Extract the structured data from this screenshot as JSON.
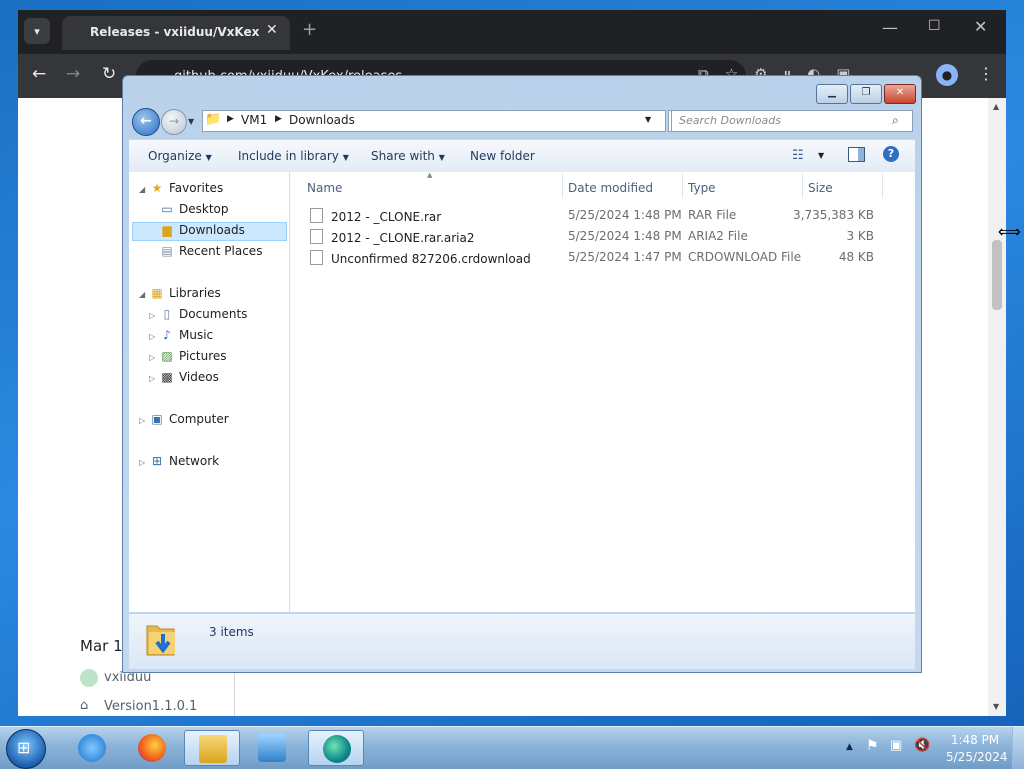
{
  "browser": {
    "tab_title": "Releases - vxiiduu/VxKex",
    "url": "github.com/vxiiduu/VxKex/releases"
  },
  "github_page": {
    "release_date": "Mar 1",
    "author": "vxiiduu",
    "tag": "Version1.1.0.1"
  },
  "explorer": {
    "breadcrumb": [
      "VM1",
      "Downloads"
    ],
    "search_placeholder": "Search Downloads",
    "commands": {
      "organize": "Organize",
      "include_in_library": "Include in library",
      "share_with": "Share with",
      "new_folder": "New folder"
    },
    "nav": {
      "favorites": "Favorites",
      "desktop": "Desktop",
      "downloads": "Downloads",
      "recent_places": "Recent Places",
      "libraries": "Libraries",
      "documents": "Documents",
      "music": "Music",
      "pictures": "Pictures",
      "videos": "Videos",
      "computer": "Computer",
      "network": "Network"
    },
    "columns": {
      "name": "Name",
      "date_modified": "Date modified",
      "type": "Type",
      "size": "Size"
    },
    "files": [
      {
        "name": "2012 - _CLONE.rar",
        "date": "5/25/2024 1:48 PM",
        "type": "RAR File",
        "size": "3,735,383 KB"
      },
      {
        "name": "2012 - _CLONE.rar.aria2",
        "date": "5/25/2024 1:48 PM",
        "type": "ARIA2 File",
        "size": "3 KB"
      },
      {
        "name": "Unconfirmed 827206.crdownload",
        "date": "5/25/2024 1:47 PM",
        "type": "CRDOWNLOAD File",
        "size": "48 KB"
      }
    ],
    "item_count": "3 items"
  },
  "taskbar": {
    "time": "1:48 PM",
    "date": "5/25/2024"
  },
  "colors": {
    "selection": "#cce8ff",
    "taskbar": "#8fb6db",
    "chrome_dark": "#202124"
  }
}
